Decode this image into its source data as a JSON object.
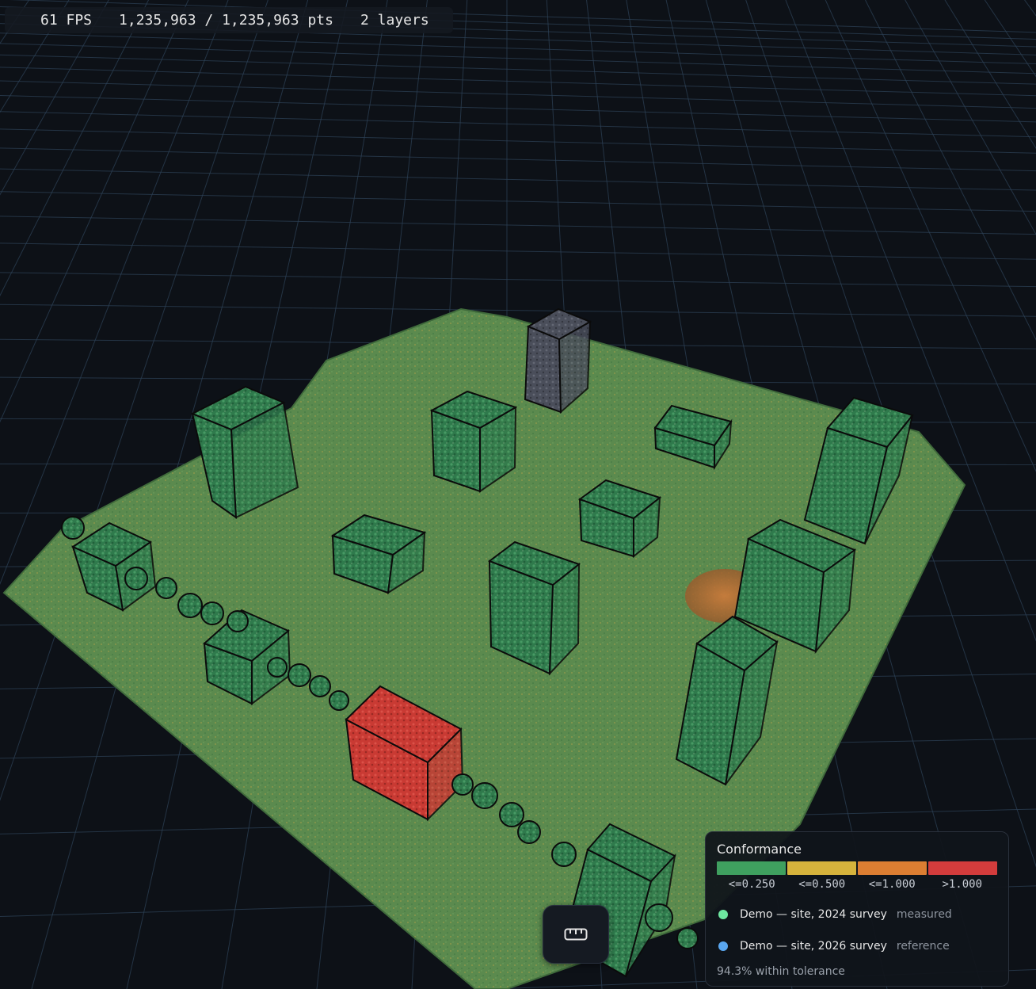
{
  "hud": {
    "fps": "61 FPS",
    "points": "1,235,963 / 1,235,963 pts",
    "layers": "2 layers"
  },
  "toolbar": {
    "measure_icon": "ruler-icon"
  },
  "colors": {
    "background": "#0d1117",
    "grid": "#2c4055",
    "ground": "#5e8a4f",
    "in_tolerance": "#3a9a5c",
    "out_of_tolerance": "#d8473f",
    "reference_building": "#4e5361"
  },
  "legend": {
    "title": "Conformance",
    "bins": [
      {
        "label": "<=0.250",
        "color": "#3fa05f"
      },
      {
        "label": "<=0.500",
        "color": "#d6b33c"
      },
      {
        "label": "<=1.000",
        "color": "#dc7e32"
      },
      {
        "label": ">1.000",
        "color": "#d33c3c"
      }
    ],
    "layers": [
      {
        "name": "Demo — site, 2024 survey",
        "role": "measured",
        "color": "#6ee7a0"
      },
      {
        "name": "Demo — site, 2026 survey",
        "role": "reference",
        "color": "#5aa7f0"
      }
    ],
    "summary": "94.3% within tolerance"
  }
}
